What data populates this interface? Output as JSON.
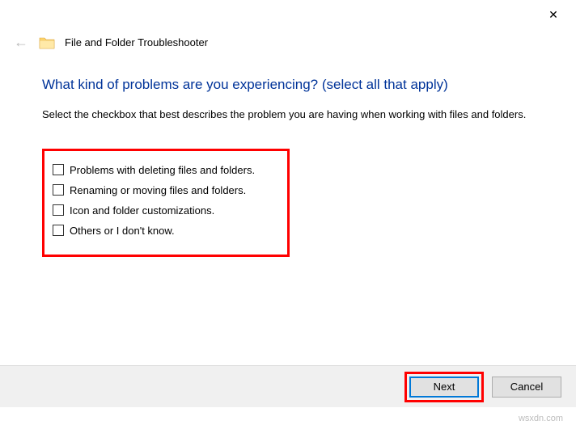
{
  "titlebar": {
    "close_glyph": "✕"
  },
  "header": {
    "back_glyph": "←",
    "title": "File and Folder Troubleshooter"
  },
  "main": {
    "heading": "What kind of problems are you experiencing? (select all that apply)",
    "description": "Select the checkbox that best describes the problem you are having when working with files and folders.",
    "options": [
      {
        "label": "Problems with deleting files and folders."
      },
      {
        "label": "Renaming or moving files and folders."
      },
      {
        "label": "Icon and folder customizations."
      },
      {
        "label": "Others or I don't know."
      }
    ]
  },
  "buttons": {
    "next": "Next",
    "cancel": "Cancel"
  },
  "watermark": "wsxdn.com"
}
